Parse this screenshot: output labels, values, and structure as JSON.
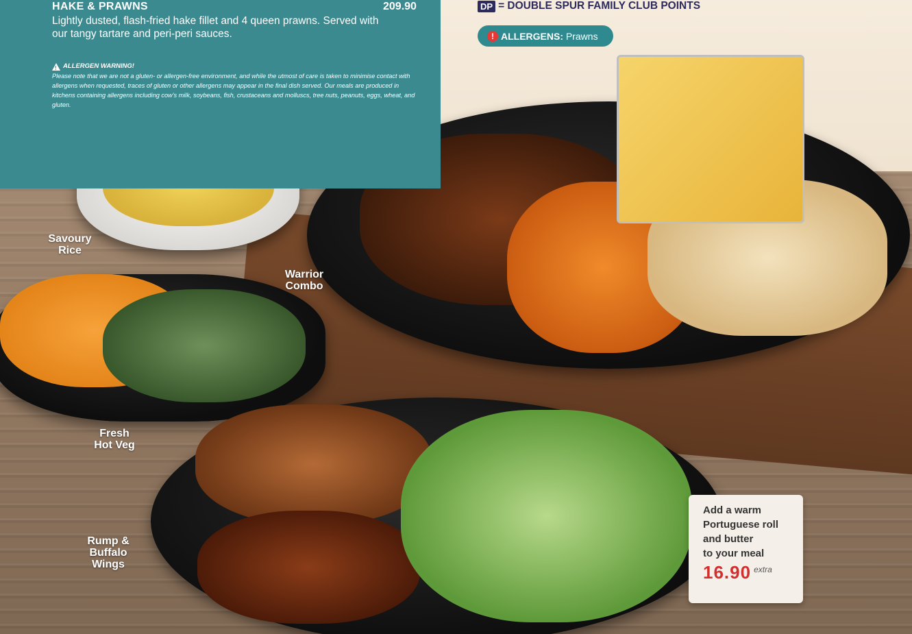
{
  "dish": {
    "title": "HAKE & PRAWNS",
    "price": "209.90",
    "description": "Lightly dusted, flash-fried hake fillet and 4 queen prawns. Served with our tangy tartare and peri-peri sauces."
  },
  "allergen_warning": {
    "heading": "ALLERGEN WARNING!",
    "body": "Please note that we are not a gluten- or allergen-free environment, and while the utmost of care is taken to minimise contact with allergens when requested, traces of gluten or other allergens may appear in the final dish served. Our meals are produced in kitchens containing allergens including cow's milk, soybeans, fish, crustaceans and molluscs, tree nuts, peanuts, eggs, wheat, and gluten."
  },
  "legend": {
    "dp_badge": "DP",
    "dp_text": "= DOUBLE SPUR FAMILY CLUB POINTS",
    "allergen_label": "ALLERGENS:",
    "allergen_value": "Prawns"
  },
  "photo_labels": {
    "savoury_rice": "Savoury\nRice",
    "warrior_combo": "Warrior\nCombo",
    "fresh_hot_veg": "Fresh\nHot Veg",
    "rump_buffalo": "Rump &\nBuffalo\nWings"
  },
  "promo": {
    "text": "Add a warm\nPortuguese roll\nand butter\nto your meal",
    "price": "16.90",
    "suffix": "extra"
  },
  "colors": {
    "teal": "#3a8a8f",
    "navy": "#2c2a5e",
    "price_red": "#d32f2f",
    "alert_red": "#e53935"
  },
  "icons": [
    "warning-triangle-icon",
    "alert-circle-icon"
  ]
}
